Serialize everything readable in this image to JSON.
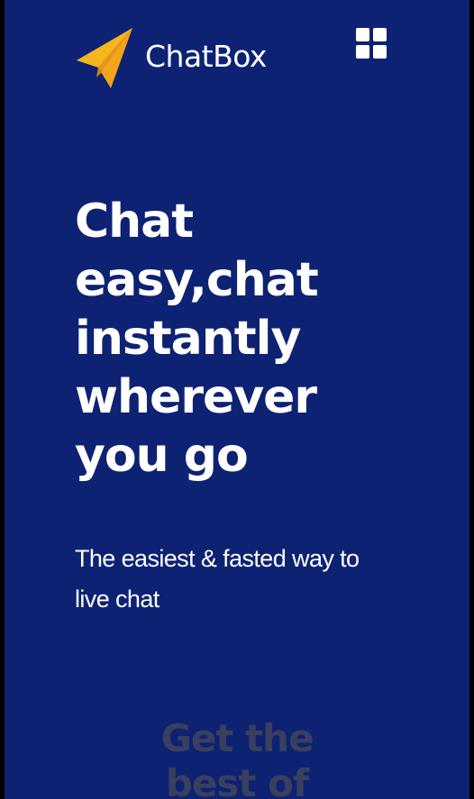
{
  "app": {
    "brand_name": "ChatBox",
    "logo_icon": "paper-plane-icon",
    "menu_icon": "grid-menu-icon"
  },
  "hero": {
    "title": "Chat easy,chat instantly wherever you go",
    "subtitle": "The easiest & fasted way to live chat"
  },
  "next_section": {
    "heading_line1": "Get the",
    "heading_line2": "best of"
  },
  "colors": {
    "background": "#0d2273",
    "text": "#ffffff",
    "logo_primary": "#f6b41d",
    "logo_shadow": "#e7961a",
    "faded_heading": "#3a3f5f"
  }
}
